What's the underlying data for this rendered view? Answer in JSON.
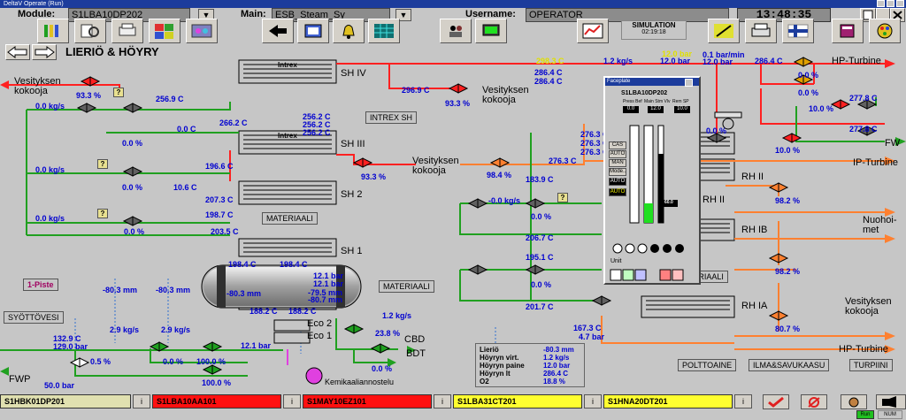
{
  "window": {
    "title": "DeltaV Operate (Run)"
  },
  "header": {
    "module_label": "Module:",
    "module_value": "S1LBA10DP202",
    "main_label": "Main:",
    "main_value": "ESB_Steam_Sy",
    "username_label": "Username:",
    "username_value": "OPERATOR",
    "time": "13:48:35",
    "sim_title": "SIMULATION",
    "sim_time": "02:19:18"
  },
  "page": {
    "title": "LIERIÖ & HÖYRY"
  },
  "sections": {
    "sh4": "SH IV",
    "sh3": "SH III",
    "sh2": "SH 2",
    "sh1": "SH 1",
    "intrex1": "Intrex",
    "intrex2": "Intrex",
    "intrex_sh": "INTREX SH",
    "materiaali1": "MATERIAALI",
    "materiaali2": "MATERIAALI",
    "materiaali3": "MATERIAALI",
    "rh2": "RH II",
    "rh2b": "RH II",
    "rh1b": "RH IB",
    "rh1a": "RH IA",
    "eco2": "Eco 2",
    "eco1": "Eco 1",
    "piste": "1-Piste",
    "syottovesi": "SYÖTTÖVESI",
    "kemikaali": "Kemikaaliannostelu",
    "fwp": "FWP",
    "cbd": "CBD",
    "bdt": "BDT"
  },
  "destinations": {
    "vesi_left_1": "Vesityksen",
    "vesi_left_2": "kokooja",
    "vesi_mid_1": "Vesityksen",
    "vesi_mid_2": "kokooja",
    "vesi_sh3_1": "Vesityksen",
    "vesi_sh3_2": "kokooja",
    "vesi_right_1": "Vesityksen",
    "vesi_right_2": "kokooja",
    "hp_turbine_top": "HP-Turbine",
    "ip_turbine": "IP-Turbine",
    "fw": "FW",
    "nuohoimet_1": "Nuohoi-",
    "nuohoimet_2": "met",
    "hp_turbine_bottom": "HP-Turbine"
  },
  "values": {
    "v_left_top_pct": "93.3 %",
    "v_256_9": "256.9 C",
    "v_0kgs_1": "0.0 kg/s",
    "v_0pct_1": "0.0 %",
    "v_0c_1": "0.0 C",
    "v_296_9": "296.9 C",
    "v_93_3b": "93.3 %",
    "v_256_2a": "256.2 C",
    "v_256_2b": "256.2 C",
    "v_256_2c": "256.2 C",
    "v_266_2": "266.2 C",
    "v_196_6": "196.6 C",
    "v_0kgs_2": "0.0 kg/s",
    "v_0pct_2": "0.0 %",
    "v_10_6": "10.6 C",
    "v_93_3c": "93.3 %",
    "v_207_3": "207.3 C",
    "v_198_7": "198.7 C",
    "v_0kgs_3": "0.0 kg/s",
    "v_0pct_3": "0.0 %",
    "v_203_5": "203.5 C",
    "v_198_4a": "198.4 C",
    "v_198_4b": "198.4 C",
    "v_12_1a": "12.1 bar",
    "v_12_1b": "12.1 bar",
    "v_80_3a": "-80.3 mm",
    "v_79_5": "-79.5 mm",
    "v_80_7": "-80.7 mm",
    "v_188_2a": "188.2 C",
    "v_188_2b": "188.2 C",
    "v_80_3b": "-80.3 mm",
    "v_80_3c": "-80.3 mm",
    "v_2_9a": "2.9 kg/s",
    "v_2_9b": "2.9 kg/s",
    "v_132_9": "132.9 C",
    "v_129_0": "129.0 bar",
    "v_0_5pct": "0.5 %",
    "v_0pct_4": "0.0 %",
    "v_100a": "100.0 %",
    "v_100b": "100.0 %",
    "v_12_1c": "12.1 bar",
    "v_50": "50.0 bar",
    "v_1_2kgs_a": "1.2 kg/s",
    "v_23_8": "23.8 %",
    "v_0pct_5": "0.0 %",
    "v_298_3": "298.3 C",
    "v_286_4a": "286.4 C",
    "v_286_4b": "286.4 C",
    "v_1_2kgs_b": "1.2 kg/s",
    "v_12_0top": "12.0 bar",
    "v_12_0mid": "12.0 bar",
    "v_0_1": "0.1 bar/min",
    "v_12_0right": "12.0 bar",
    "v_286_4c": "286.4 C",
    "v_0pct_6": "0.0 %",
    "v_0pct_7": "0.0 %",
    "v_10pct_a": "10.0 %",
    "v_277_8a": "277.8 C",
    "v_0pct_8": "0.0 %",
    "v_10pct_b": "10.0 %",
    "v_277_8b": "277.8 C",
    "v_276_3a": "276.3 C",
    "v_276_3b": "276.3 C",
    "v_276_3c": "276.3 C",
    "v_276_3d": "276.3 C",
    "v_98_4": "98.4 %",
    "v_183_9": "183.9 C",
    "v_0kgs_4": "-0.0 kg/s",
    "v_0pct_9": "0.0 %",
    "v_206_7": "206.7 C",
    "v_195_1": "195.1 C",
    "v_0pct_10": "0.0 %",
    "v_201_7": "201.7 C",
    "v_98_2a": "98.2 %",
    "v_98_2b": "98.2 %",
    "v_167_3": "167.3 C",
    "v_4_7": "4.7 bar",
    "v_80_7pct": "80.7 %"
  },
  "summary": {
    "rows": [
      {
        "label": "Lieriö",
        "value": "-80.3 mm"
      },
      {
        "label": "Höyryn virt.",
        "value": "1.2 kg/s"
      },
      {
        "label": "Höyryn paine",
        "value": "12.0 bar"
      },
      {
        "label": "Höyryn lt",
        "value": "286.4 C"
      },
      {
        "label": "O2",
        "value": "18.8 %"
      }
    ]
  },
  "faceplate": {
    "title": "Faceplate",
    "tag": "S1LBA10DP202",
    "col1": "Press Bef",
    "col2": "Main Stm Vlv",
    "col3": "Rem SP",
    "pv1": "0.0",
    "pv2": "12.0",
    "pv3": "10.0",
    "modes": [
      "CAS",
      "AUTO",
      "MAN",
      "Mode..",
      "AUTO",
      "AUTO"
    ],
    "out": "60.0",
    "unit": "Unit"
  },
  "buttons": {
    "polttoaine": "POLTTOAINE",
    "ilma": "ILMA&SAVUKAASU",
    "turpiini": "TURPIINI"
  },
  "alarms": [
    {
      "tag": "S1HBK01DP201",
      "color": "#e0e0b0"
    },
    {
      "tag": "S1LBA10AA101",
      "color": "#ff1010"
    },
    {
      "tag": "S1MAY10EZ101",
      "color": "#ff1010"
    },
    {
      "tag": "S1LBA31CT201",
      "color": "#ffff30"
    },
    {
      "tag": "S1HNA20DT201",
      "color": "#ffff30"
    }
  ],
  "info_label": "i",
  "status": {
    "run": "Run",
    "num": "NUM"
  },
  "colors": {
    "steam": "#ff2020",
    "water": "#20a020",
    "reheat": "#ff8030",
    "signal": "#3070d0"
  }
}
